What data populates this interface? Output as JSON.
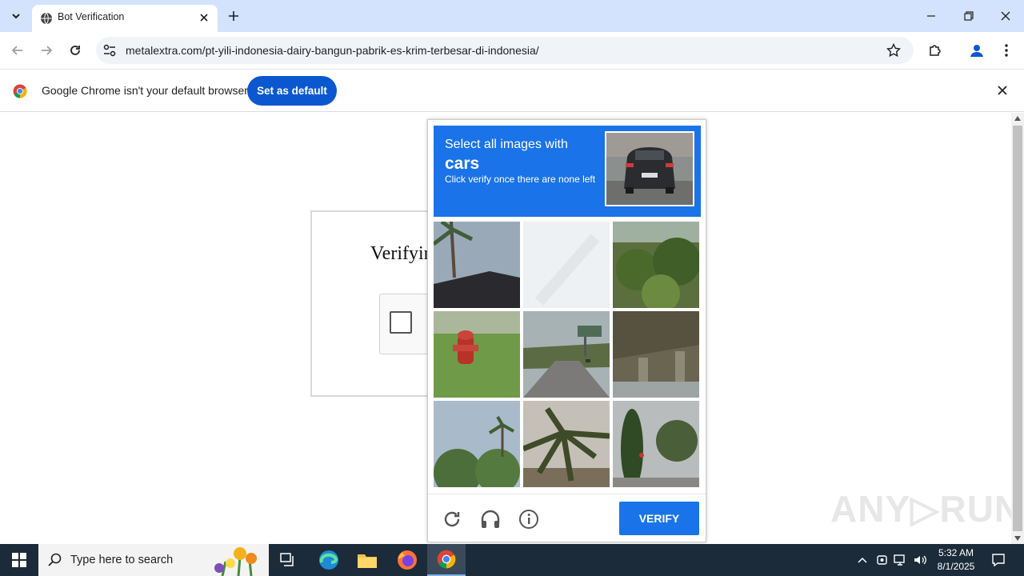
{
  "browser": {
    "tab_title": "Bot Verification",
    "url": "metalextra.com/pt-yili-indonesia-dairy-bangun-pabrik-es-krim-terbesar-di-indonesia/",
    "infobar_text": "Google Chrome isn't your default browser",
    "set_default_label": "Set as default"
  },
  "page": {
    "verify_title": "Verifying you are human"
  },
  "captcha": {
    "line1": "Select all images with",
    "line2": "cars",
    "line3": "Click verify once there are none left",
    "verify_label": "VERIFY"
  },
  "watermark": "ANY▷RUN",
  "taskbar": {
    "search_placeholder": "Type here to search",
    "time": "5:32 AM",
    "date": "8/1/2025"
  },
  "colors": {
    "accent": "#1a73e8",
    "chrome_blue": "#0b57d0",
    "tabstrip": "#d3e3fd",
    "taskbar": "#1c2b3a"
  }
}
